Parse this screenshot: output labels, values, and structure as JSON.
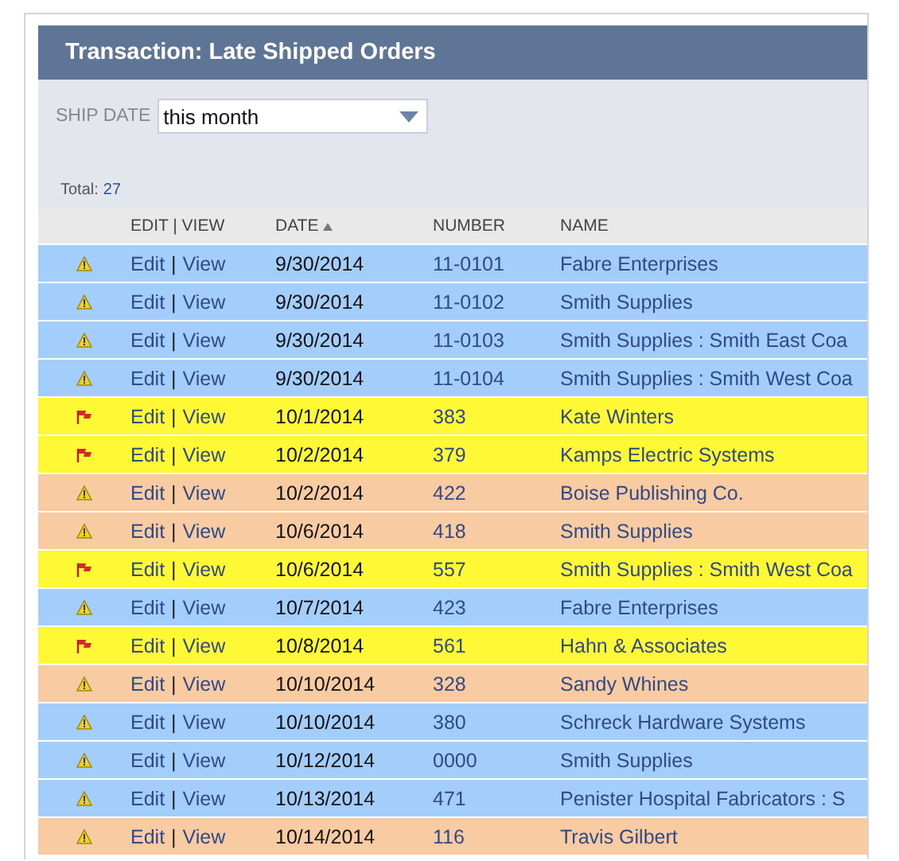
{
  "window": {
    "title": "Transaction: Late Shipped Orders"
  },
  "filter": {
    "label": "SHIP DATE",
    "value": "this month"
  },
  "total": {
    "label": "Total:",
    "count": "27"
  },
  "table": {
    "columns": [
      {
        "label": "EDIT | VIEW"
      },
      {
        "label": "DATE",
        "sorted": true
      },
      {
        "label": "NUMBER"
      },
      {
        "label": "NAME"
      }
    ],
    "rows": [
      {
        "kind": "warning",
        "color": "#a3cdfb",
        "edit": "Edit",
        "sep": "|",
        "view": "View",
        "date": "9/30/2014",
        "number": "11-0101",
        "name": "Fabre Enterprises"
      },
      {
        "kind": "warning",
        "color": "#a3cdfb",
        "edit": "Edit",
        "sep": "|",
        "view": "View",
        "date": "9/30/2014",
        "number": "11-0102",
        "name": "Smith Supplies"
      },
      {
        "kind": "warning",
        "color": "#a3cdfb",
        "edit": "Edit",
        "sep": "|",
        "view": "View",
        "date": "9/30/2014",
        "number": "11-0103",
        "name": "Smith Supplies : Smith East Coa"
      },
      {
        "kind": "warning",
        "color": "#a3cdfb",
        "edit": "Edit",
        "sep": "|",
        "view": "View",
        "date": "9/30/2014",
        "number": "11-0104",
        "name": "Smith Supplies : Smith West Coa"
      },
      {
        "kind": "flag",
        "color": "#fff835",
        "edit": "Edit",
        "sep": "|",
        "view": "View",
        "date": "10/1/2014",
        "number": "383",
        "name": "Kate Winters"
      },
      {
        "kind": "flag",
        "color": "#fff835",
        "edit": "Edit",
        "sep": "|",
        "view": "View",
        "date": "10/2/2014",
        "number": "379",
        "name": "Kamps Electric Systems"
      },
      {
        "kind": "warning",
        "color": "#f8cba3",
        "edit": "Edit",
        "sep": "|",
        "view": "View",
        "date": "10/2/2014",
        "number": "422",
        "name": "Boise Publishing Co."
      },
      {
        "kind": "warning",
        "color": "#f8cba3",
        "edit": "Edit",
        "sep": "|",
        "view": "View",
        "date": "10/6/2014",
        "number": "418",
        "name": "Smith Supplies"
      },
      {
        "kind": "flag",
        "color": "#fff835",
        "edit": "Edit",
        "sep": "|",
        "view": "View",
        "date": "10/6/2014",
        "number": "557",
        "name": "Smith Supplies : Smith West Coa"
      },
      {
        "kind": "warning",
        "color": "#a3cdfb",
        "edit": "Edit",
        "sep": "|",
        "view": "View",
        "date": "10/7/2014",
        "number": "423",
        "name": "Fabre Enterprises"
      },
      {
        "kind": "flag",
        "color": "#fff835",
        "edit": "Edit",
        "sep": "|",
        "view": "View",
        "date": "10/8/2014",
        "number": "561",
        "name": "Hahn & Associates"
      },
      {
        "kind": "warning",
        "color": "#f8cba3",
        "edit": "Edit",
        "sep": "|",
        "view": "View",
        "date": "10/10/2014",
        "number": "328",
        "name": "Sandy Whines"
      },
      {
        "kind": "warning",
        "color": "#a3cdfb",
        "edit": "Edit",
        "sep": "|",
        "view": "View",
        "date": "10/10/2014",
        "number": "380",
        "name": "Schreck Hardware Systems"
      },
      {
        "kind": "warning",
        "color": "#a3cdfb",
        "edit": "Edit",
        "sep": "|",
        "view": "View",
        "date": "10/12/2014",
        "number": "0000",
        "name": "Smith Supplies"
      },
      {
        "kind": "warning",
        "color": "#a3cdfb",
        "edit": "Edit",
        "sep": "|",
        "view": "View",
        "date": "10/13/2014",
        "number": "471",
        "name": "Penister Hospital Fabricators : S"
      },
      {
        "kind": "warning",
        "color": "#f8cba3",
        "edit": "Edit",
        "sep": "|",
        "view": "View",
        "date": "10/14/2014",
        "number": "116",
        "name": "Travis Gilbert"
      }
    ]
  }
}
